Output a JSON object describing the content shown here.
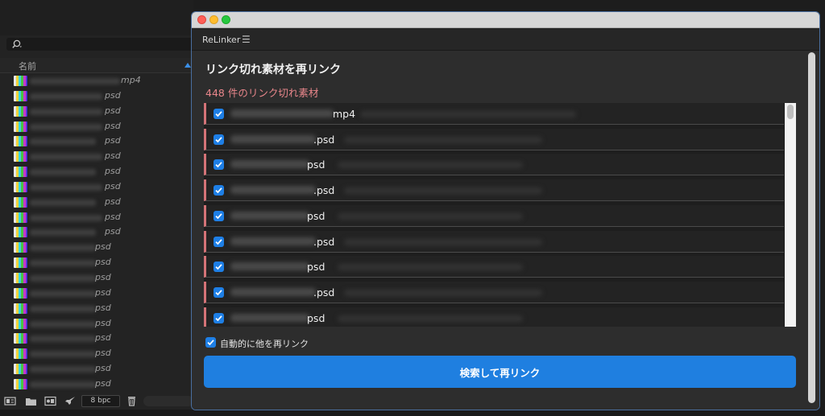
{
  "project_panel": {
    "column_header": "名前",
    "files": [
      {
        "ext": "mp4",
        "blur_w": 112
      },
      {
        "ext": "psd",
        "blur_w": 90
      },
      {
        "ext": "psd",
        "blur_w": 90
      },
      {
        "ext": "psd",
        "blur_w": 90
      },
      {
        "ext": "psd",
        "blur_w": 82
      },
      {
        "ext": "psd",
        "blur_w": 90
      },
      {
        "ext": "psd",
        "blur_w": 82
      },
      {
        "ext": "psd",
        "blur_w": 90
      },
      {
        "ext": "psd",
        "blur_w": 82
      },
      {
        "ext": "psd",
        "blur_w": 90
      },
      {
        "ext": "psd",
        "blur_w": 82
      },
      {
        "ext": "psd",
        "blur_w": 82
      },
      {
        "ext": "psd",
        "blur_w": 82
      },
      {
        "ext": "psd",
        "blur_w": 82
      },
      {
        "ext": "psd",
        "blur_w": 82
      },
      {
        "ext": "psd",
        "blur_w": 82
      },
      {
        "ext": "psd",
        "blur_w": 82
      },
      {
        "ext": "psd",
        "blur_w": 82
      },
      {
        "ext": "psd",
        "blur_w": 82
      },
      {
        "ext": "psd",
        "blur_w": 82
      },
      {
        "ext": "psd",
        "blur_w": 82
      }
    ],
    "bit_depth": "8 bpc"
  },
  "window": {
    "panel_name": "ReLinker",
    "menu_icon": "hamburger-icon",
    "heading": "リンク切れ素材を再リンク",
    "missing_count": "448 件のリンク切れ素材",
    "missing_items": [
      {
        "ext": "mp4",
        "checked": true
      },
      {
        "ext": ".psd",
        "checked": true
      },
      {
        "ext": "psd",
        "checked": true
      },
      {
        "ext": ".psd",
        "checked": true
      },
      {
        "ext": "psd",
        "checked": true
      },
      {
        "ext": ".psd",
        "checked": true
      },
      {
        "ext": "psd",
        "checked": true
      },
      {
        "ext": ".psd",
        "checked": true
      },
      {
        "ext": "psd",
        "checked": true
      }
    ],
    "auto_relink_label": "自動的に他を再リンク",
    "auto_relink_checked": true,
    "relink_button": "検索して再リンク"
  },
  "colors": {
    "accent": "#1f7fe0",
    "missing_marker": "#d47377",
    "count_text": "#e9868b"
  }
}
